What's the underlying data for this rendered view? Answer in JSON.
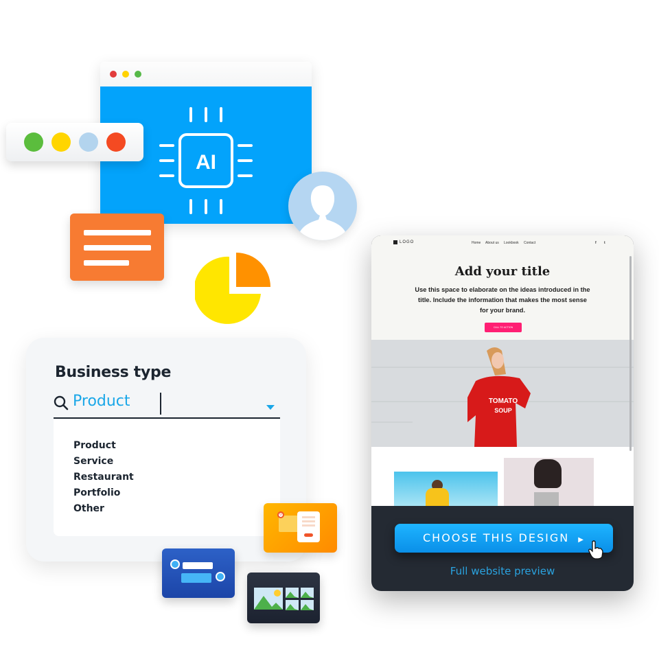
{
  "ai_window": {
    "window_controls": [
      "close",
      "minimize",
      "maximize"
    ],
    "chip_label": "AI",
    "colors": {
      "body": "#03a3fb",
      "close": "#e23c3c",
      "minimize": "#ffd200",
      "maximize": "#56b948"
    }
  },
  "color_palette": {
    "swatches": [
      "#5bbd3d",
      "#ffd500",
      "#b3d4ee",
      "#f44a22"
    ]
  },
  "business_type": {
    "title": "Business type",
    "search_value": "Product",
    "options": [
      "Product",
      "Service",
      "Restaurant",
      "Portfolio",
      "Other"
    ],
    "accent": "#1aa7e8"
  },
  "template_preview": {
    "logo": "LOGO",
    "nav": [
      "Home",
      "About us",
      "Lookbook",
      "Contact"
    ],
    "social": [
      "f",
      "t"
    ],
    "title": "Add your title",
    "description": "Use this space to elaborate on the ideas introduced in the title. Include the information that makes the most sense for your brand.",
    "cta": "CALL TO ACTION",
    "hero_text": [
      "TOMATO",
      "SOUP"
    ],
    "choose_button": "CHOOSE THIS DESIGN",
    "full_preview_link": "Full website preview"
  },
  "icons": {
    "email_badge": "0"
  }
}
